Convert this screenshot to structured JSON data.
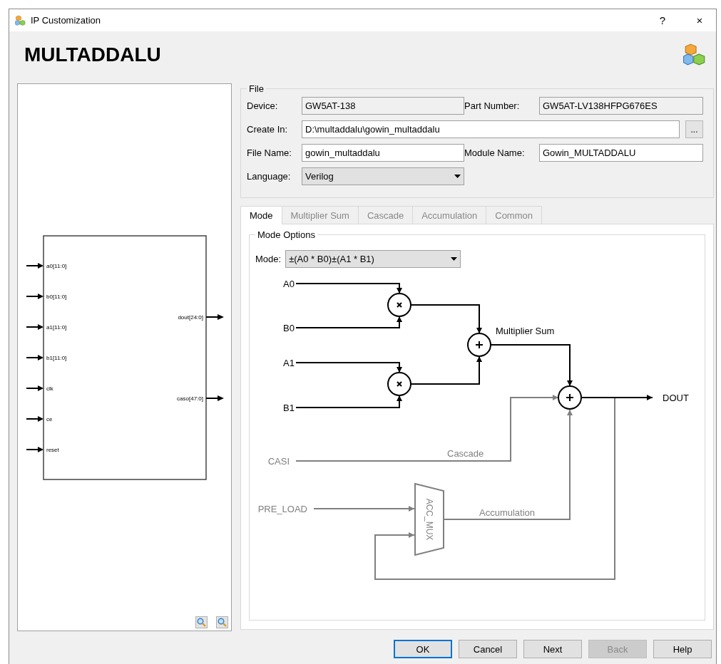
{
  "window": {
    "title": "IP Customization",
    "help_button": "?",
    "close_button": "×"
  },
  "header": {
    "title": "MULTADDALU"
  },
  "symbol": {
    "inputs": [
      "a0[11:0]",
      "b0[11:0]",
      "a1[11:0]",
      "b1[11:0]",
      "clk",
      "ce",
      "reset"
    ],
    "outputs": [
      "dout[24:0]",
      "caso[47:0]"
    ]
  },
  "file": {
    "title": "File",
    "device": {
      "label": "Device:",
      "value": "GW5AT-138"
    },
    "part_number": {
      "label": "Part Number:",
      "value": "GW5AT-LV138HFPG676ES"
    },
    "create_in": {
      "label": "Create In:",
      "value": "D:\\multaddalu\\gowin_multaddalu",
      "browse": "..."
    },
    "file_name": {
      "label": "File Name:",
      "value": "gowin_multaddalu"
    },
    "module_name": {
      "label": "Module Name:",
      "value": "Gowin_MULTADDALU"
    },
    "language": {
      "label": "Language:",
      "value": "Verilog"
    }
  },
  "tabs": [
    {
      "label": "Mode",
      "selected": true
    },
    {
      "label": "Multiplier Sum",
      "selected": false
    },
    {
      "label": "Cascade",
      "selected": false
    },
    {
      "label": "Accumulation",
      "selected": false
    },
    {
      "label": "Common",
      "selected": false
    }
  ],
  "mode_options": {
    "title": "Mode Options",
    "mode": {
      "label": "Mode:",
      "value": "±(A0 * B0)±(A1 * B1)"
    },
    "diagram": {
      "a0": "A0",
      "b0": "B0",
      "a1": "A1",
      "b1": "B1",
      "multiplier_sum": "Multiplier Sum",
      "dout": "DOUT",
      "casi": "CASI",
      "cascade": "Cascade",
      "pre_load": "PRE_LOAD",
      "acc_mux": "ACC_MUX",
      "accumulation": "Accumulation"
    }
  },
  "buttons": [
    {
      "label": "OK",
      "focused": true,
      "disabled": false
    },
    {
      "label": "Cancel",
      "focused": false,
      "disabled": false
    },
    {
      "label": "Next",
      "focused": false,
      "disabled": false
    },
    {
      "label": "Back",
      "focused": false,
      "disabled": true
    },
    {
      "label": "Help",
      "focused": false,
      "disabled": false
    }
  ]
}
